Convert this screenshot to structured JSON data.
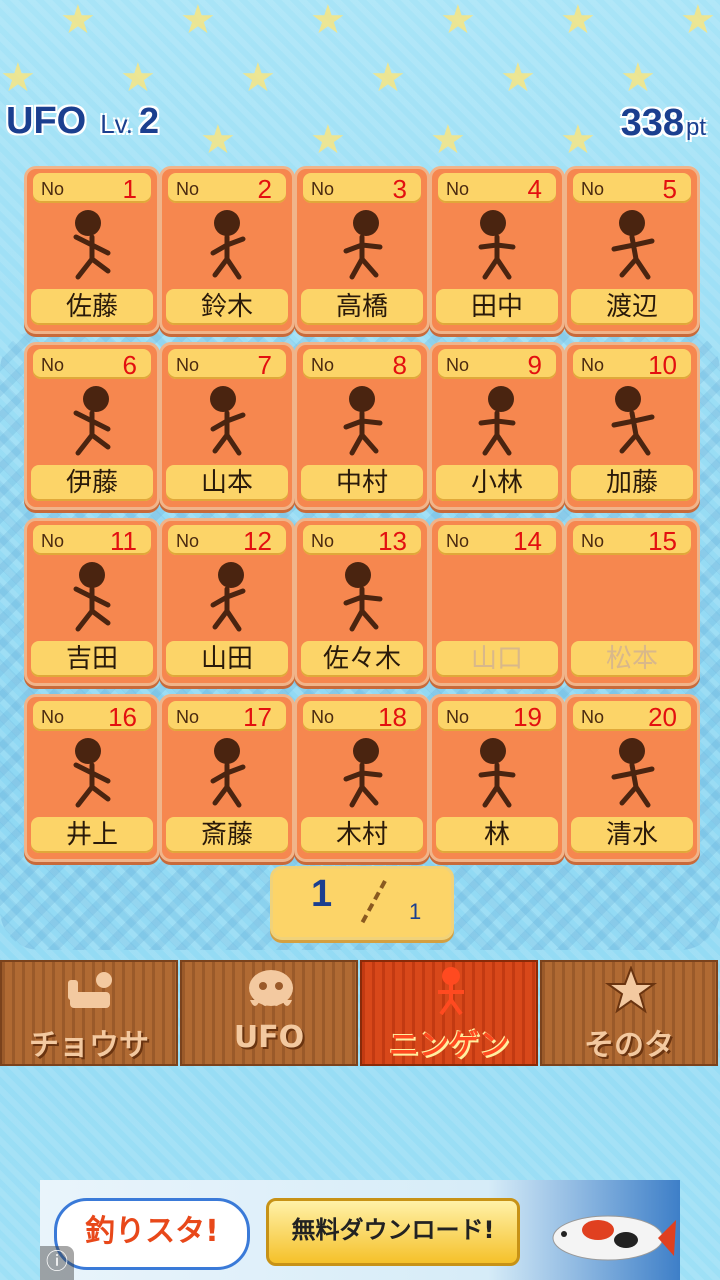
{
  "header": {
    "title": "UFO",
    "level_label": "Lv.",
    "level": "2",
    "points": "338",
    "points_unit": "pt"
  },
  "cards": [
    {
      "no_label": "No",
      "num": "1",
      "name": "佐藤",
      "discovered": true
    },
    {
      "no_label": "No",
      "num": "2",
      "name": "鈴木",
      "discovered": true
    },
    {
      "no_label": "No",
      "num": "3",
      "name": "高橋",
      "discovered": true
    },
    {
      "no_label": "No",
      "num": "4",
      "name": "田中",
      "discovered": true
    },
    {
      "no_label": "No",
      "num": "5",
      "name": "渡辺",
      "discovered": true
    },
    {
      "no_label": "No",
      "num": "6",
      "name": "伊藤",
      "discovered": true
    },
    {
      "no_label": "No",
      "num": "7",
      "name": "山本",
      "discovered": true
    },
    {
      "no_label": "No",
      "num": "8",
      "name": "中村",
      "discovered": true
    },
    {
      "no_label": "No",
      "num": "9",
      "name": "小林",
      "discovered": true
    },
    {
      "no_label": "No",
      "num": "10",
      "name": "加藤",
      "discovered": true
    },
    {
      "no_label": "No",
      "num": "11",
      "name": "吉田",
      "discovered": true
    },
    {
      "no_label": "No",
      "num": "12",
      "name": "山田",
      "discovered": true
    },
    {
      "no_label": "No",
      "num": "13",
      "name": "佐々木",
      "discovered": true
    },
    {
      "no_label": "No",
      "num": "14",
      "name": "山口",
      "discovered": false
    },
    {
      "no_label": "No",
      "num": "15",
      "name": "松本",
      "discovered": false
    },
    {
      "no_label": "No",
      "num": "16",
      "name": "井上",
      "discovered": true
    },
    {
      "no_label": "No",
      "num": "17",
      "name": "斎藤",
      "discovered": true
    },
    {
      "no_label": "No",
      "num": "18",
      "name": "木村",
      "discovered": true
    },
    {
      "no_label": "No",
      "num": "19",
      "name": "林",
      "discovered": true
    },
    {
      "no_label": "No",
      "num": "20",
      "name": "清水",
      "discovered": true
    }
  ],
  "pager": {
    "current": "1",
    "total": "1"
  },
  "tabs": [
    {
      "label": "チョウサ",
      "icon": "survey-icon",
      "active": false
    },
    {
      "label": "UFO",
      "icon": "ufo-icon",
      "active": false
    },
    {
      "label": "ニンゲン",
      "icon": "human-icon",
      "active": true
    },
    {
      "label": "そのタ",
      "icon": "star-icon",
      "active": false
    }
  ],
  "ad": {
    "logo_text": "釣りスタ!",
    "download_label": "無料ダウンロード!",
    "info_icon": "info-icon"
  },
  "colors": {
    "card": "#f6874f",
    "label_bg": "#fcd468",
    "number": "#e31010",
    "title": "#1b3f8f",
    "active_tab": "#d8481a"
  }
}
